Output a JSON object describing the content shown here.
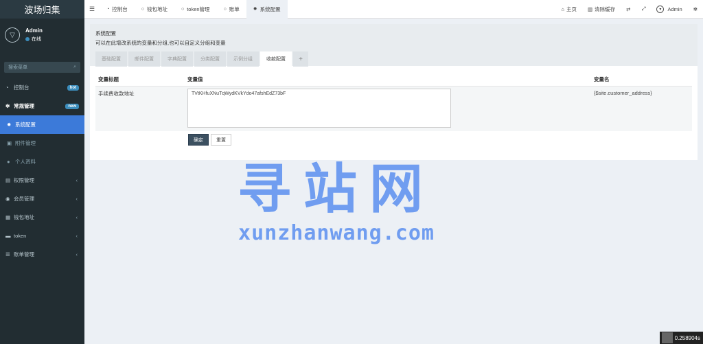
{
  "app": {
    "title": "波场归集"
  },
  "user": {
    "name": "Admin",
    "status": "在线"
  },
  "search": {
    "placeholder": "搜索菜单"
  },
  "menu": [
    {
      "label": "控制台",
      "icon": "dashboard-icon",
      "badge": "hot"
    },
    {
      "label": "常规管理",
      "icon": "cogs-icon",
      "badge": "new"
    },
    {
      "label": "系统配置",
      "icon": "gear-icon"
    },
    {
      "label": "附件管理",
      "icon": "attachment-icon"
    },
    {
      "label": "个人资料",
      "icon": "user-icon"
    },
    {
      "label": "权限管理",
      "icon": "group-icon"
    },
    {
      "label": "会员管理",
      "icon": "member-icon"
    },
    {
      "label": "钱包地址",
      "icon": "wallet-icon"
    },
    {
      "label": "token",
      "icon": "token-icon"
    },
    {
      "label": "账单管理",
      "icon": "list-icon"
    }
  ],
  "topbar": {
    "tabs": [
      "控制台",
      "钱包地址",
      "token管理",
      "账单",
      "系统配置"
    ],
    "home": "主页",
    "clear_cache": "清除缓存",
    "admin": "Admin"
  },
  "panel": {
    "title": "系统配置",
    "desc": "可以在此增改系统的变量和分组,也可以自定义分组和变量",
    "tabs": [
      "基础配置",
      "邮件配置",
      "字典配置",
      "分类配置",
      "示例分组",
      "收款配置"
    ],
    "plus": "+",
    "headers": [
      "变量标题",
      "变量值",
      "变量名"
    ],
    "row": {
      "title": "手续费收款地址",
      "value": "TVtKHfuXNuTqWydKVkYdo47afshEdZ73bF",
      "name": "{$site.customer_address}"
    },
    "confirm": "确定",
    "reset": "重置"
  },
  "watermark": {
    "cn": "寻站网",
    "en": "xunzhanwang.com"
  },
  "timer": "0.258904s"
}
